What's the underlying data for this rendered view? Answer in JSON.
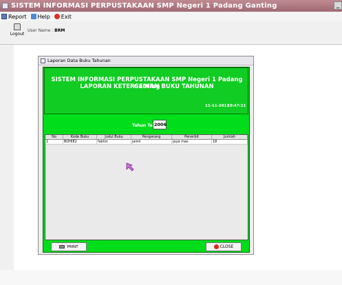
{
  "window": {
    "title": "SISTEM INFORMASI PERPUSTAKAAN SMP Negeri 1 Padang Ganting"
  },
  "menu": {
    "items": [
      {
        "label": "Report",
        "icon": "report-icon"
      },
      {
        "label": "Help",
        "icon": "help-icon"
      },
      {
        "label": "Exit",
        "icon": "exit-icon"
      }
    ]
  },
  "toolbar": {
    "logout_label": "Logout",
    "user_prefix": "User Name :",
    "user_value": "BRM"
  },
  "report_window": {
    "title": "Laporan Data Buku Tahunan",
    "header_line1": "SISTEM INFORMASI PERPUSTAKAAN SMP Negeri 1 Padang Ganting",
    "header_line2": "LAPORAN KETERSEDIAN BUKU TAHUNAN",
    "date": "11-11-2013",
    "time": "10:47:11",
    "year_label": "Tahun Terbit",
    "year_value": "2006",
    "table": {
      "columns": [
        "No",
        "Kode Buku",
        "Judul Buku",
        "Pengarang",
        "Penerbit",
        "Jumlah"
      ],
      "rows": [
        [
          "1",
          "BOHIE2",
          "faktor",
          "jamil",
          "jaya mas",
          "18"
        ]
      ]
    },
    "print_label": "PRINT",
    "close_label": "CLOSE"
  },
  "colors": {
    "frame_green": "#00dd1a",
    "header_green": "#11cc22",
    "titlebar": "#a06a74"
  }
}
